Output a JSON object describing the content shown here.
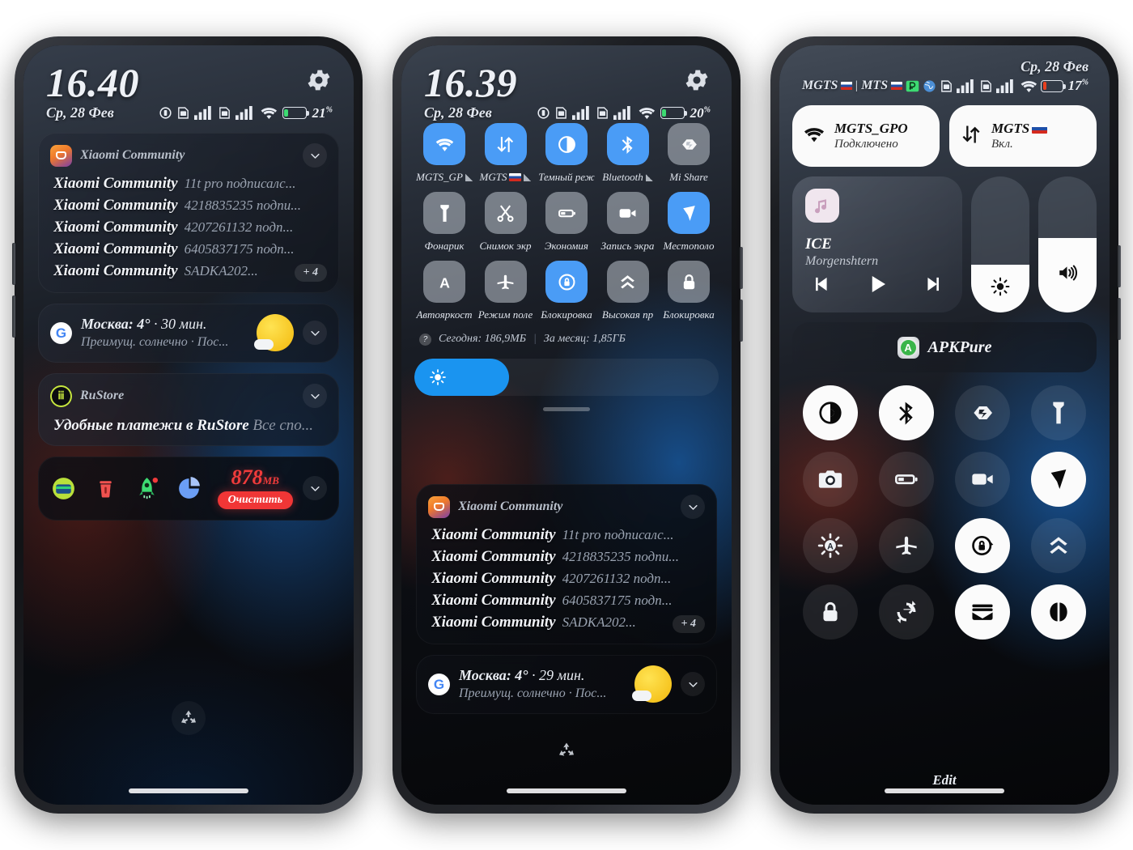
{
  "phone1": {
    "clock": "16.40",
    "date": "Ср, 28 Фев",
    "battery_pct": "21",
    "battery_level": 21,
    "notifications": {
      "xiaomi": {
        "app": "Xiaomi Community",
        "more": "+ 4",
        "rows": [
          {
            "title": "Xiaomi Community",
            "sub": "11t pro подписалс..."
          },
          {
            "title": "Xiaomi Community",
            "sub": "4218835235 подпи..."
          },
          {
            "title": "Xiaomi Community",
            "sub": "4207261132 подп..."
          },
          {
            "title": "Xiaomi Community",
            "sub": "6405837175 подп..."
          },
          {
            "title": "Xiaomi Community",
            "sub": "SADKA202..."
          }
        ]
      },
      "weather": {
        "line1_bold": "Москва: 4°",
        "line1_rest": " · 30 мин.",
        "line2": "Преимущ. солнечно · Пос..."
      },
      "rustore": {
        "app": "RuStore",
        "body_bold": "Удобные платежи в RuStore",
        "body_rest": " Все спо..."
      },
      "cleaner": {
        "size": "878",
        "unit": "МВ",
        "button": "Очистить"
      }
    }
  },
  "phone2": {
    "clock": "16.39",
    "date": "Ср, 28 Фев",
    "battery_pct": "20",
    "battery_level": 20,
    "tiles": [
      {
        "label": "MGTS_GP",
        "icon": "wifi-icon",
        "state": "on",
        "badge": "signal"
      },
      {
        "label": "MGTS",
        "icon": "data-icon",
        "state": "on",
        "badge": "flag-signal"
      },
      {
        "label": "Темный реж",
        "icon": "dark-mode-icon",
        "state": "on",
        "badge": ""
      },
      {
        "label": "Bluetooth",
        "icon": "bluetooth-icon",
        "state": "on",
        "badge": "signal"
      },
      {
        "label": "Mi Share",
        "icon": "mi-share-icon",
        "state": "off",
        "badge": ""
      },
      {
        "label": "Фонарик",
        "icon": "flashlight-icon",
        "state": "off",
        "badge": ""
      },
      {
        "label": "Снимок экр",
        "icon": "scissors-icon",
        "state": "off",
        "badge": ""
      },
      {
        "label": "Экономия",
        "icon": "battery-saver-icon",
        "state": "off",
        "badge": ""
      },
      {
        "label": "Запись экра",
        "icon": "video-record-icon",
        "state": "off",
        "badge": ""
      },
      {
        "label": "Местополо",
        "icon": "location-icon",
        "state": "on",
        "badge": ""
      },
      {
        "label": "Автояркост",
        "icon": "auto-brightness-icon",
        "state": "off",
        "badge": ""
      },
      {
        "label": "Режим поле",
        "icon": "airplane-icon",
        "state": "off",
        "badge": ""
      },
      {
        "label": "Блокировка",
        "icon": "rotation-lock-icon",
        "state": "on",
        "badge": ""
      },
      {
        "label": "Высокая пр",
        "icon": "chevrons-up-icon",
        "state": "off",
        "badge": ""
      },
      {
        "label": "Блокировка",
        "icon": "padlock-icon",
        "state": "off",
        "badge": ""
      }
    ],
    "usage": {
      "today": "Сегодня: 186,9МБ",
      "separator": "|",
      "month": "За месяц: 1,85ГБ"
    },
    "brightness_pct": 31,
    "notifications": {
      "xiaomi": {
        "app": "Xiaomi Community",
        "more": "+ 4",
        "rows": [
          {
            "title": "Xiaomi Community",
            "sub": "11t pro подписалс..."
          },
          {
            "title": "Xiaomi Community",
            "sub": "4218835235 подпи..."
          },
          {
            "title": "Xiaomi Community",
            "sub": "4207261132 подп..."
          },
          {
            "title": "Xiaomi Community",
            "sub": "6405837175 подп..."
          },
          {
            "title": "Xiaomi Community",
            "sub": "SADKA202..."
          }
        ]
      },
      "weather": {
        "line1_bold": "Москва: 4°",
        "line1_rest": " · 29 мин.",
        "line2": "Преимущ. солнечно · Пос..."
      }
    }
  },
  "phone3": {
    "date": "Ср, 28 Фев",
    "carrier1": "MGTS",
    "carrier_sep": "|",
    "carrier2": "MTS",
    "battery_pct": "17",
    "battery_level": 17,
    "wifi_tile": {
      "name": "MGTS_GPO",
      "status": "Подключено",
      "icon": "wifi-icon"
    },
    "data_tile": {
      "name": "MGTS",
      "status": "Вкл.",
      "icon": "data-icon"
    },
    "media": {
      "title": "ICE",
      "artist": "Morgenshtern"
    },
    "brightness_pct": 35,
    "volume_pct": 55,
    "app_shortcut": {
      "name": "APKPure"
    },
    "controls": [
      {
        "name": "dark-mode-toggle",
        "icon": "contrast-icon",
        "state": "on"
      },
      {
        "name": "bluetooth-toggle",
        "icon": "bluetooth-icon",
        "state": "on"
      },
      {
        "name": "mi-share-toggle",
        "icon": "mi-share-icon",
        "state": "off"
      },
      {
        "name": "flashlight-toggle",
        "icon": "flashlight-icon",
        "state": "off"
      },
      {
        "name": "camera-toggle",
        "icon": "camera-icon",
        "state": "off"
      },
      {
        "name": "battery-saver-toggle",
        "icon": "battery-saver-icon",
        "state": "off"
      },
      {
        "name": "screen-record-toggle",
        "icon": "video-record-icon",
        "state": "off"
      },
      {
        "name": "location-toggle",
        "icon": "location-icon",
        "state": "on"
      },
      {
        "name": "auto-brightness-toggle",
        "icon": "auto-brightness-icon",
        "state": "off"
      },
      {
        "name": "airplane-toggle",
        "icon": "airplane-icon",
        "state": "off"
      },
      {
        "name": "rotation-lock-toggle",
        "icon": "rotation-lock-icon",
        "state": "on"
      },
      {
        "name": "high-performance-toggle",
        "icon": "chevrons-up-icon",
        "state": "off"
      },
      {
        "name": "screen-lock-toggle",
        "icon": "padlock-icon",
        "state": "off"
      },
      {
        "name": "sync-toggle",
        "icon": "sync-icon",
        "state": "off"
      },
      {
        "name": "wallet-toggle",
        "icon": "wallet-icon",
        "state": "on"
      },
      {
        "name": "reading-mode-toggle",
        "icon": "reading-mode-icon",
        "state": "on"
      }
    ],
    "edit_label": "Edit"
  }
}
